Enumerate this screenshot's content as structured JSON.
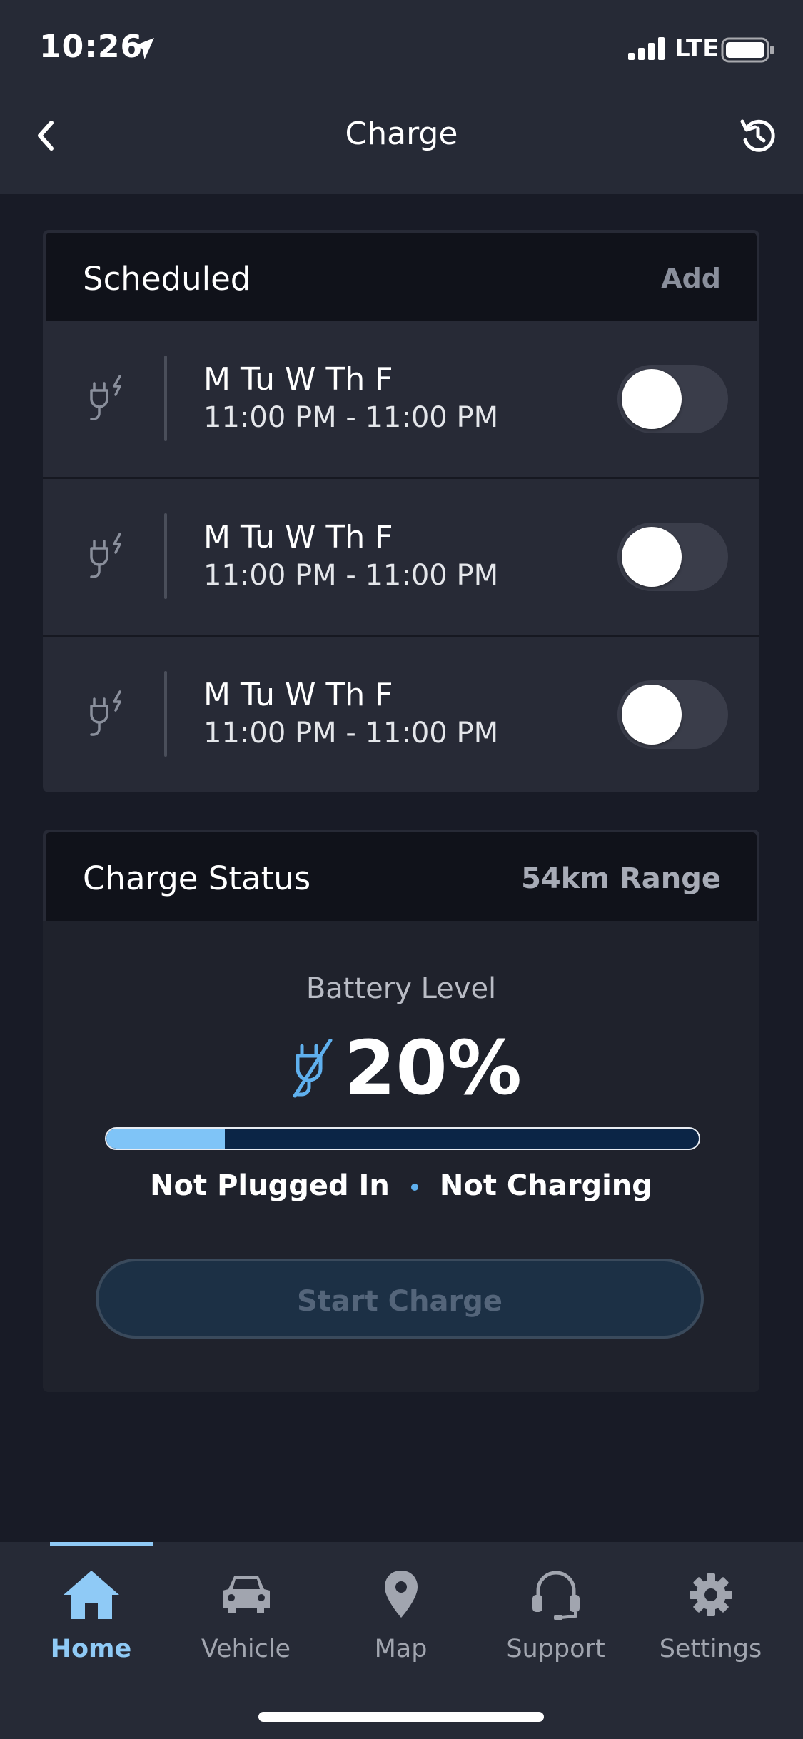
{
  "status_bar": {
    "time": "10:26",
    "network": "LTE"
  },
  "header": {
    "title": "Charge"
  },
  "scheduled": {
    "title": "Scheduled",
    "action": "Add",
    "items": [
      {
        "days": "M Tu W Th F",
        "time_range": "11:00 PM - 11:00 PM",
        "enabled": false
      },
      {
        "days": "M Tu W Th F",
        "time_range": "11:00 PM - 11:00 PM",
        "enabled": false
      },
      {
        "days": "M Tu W Th F",
        "time_range": "11:00 PM - 11:00 PM",
        "enabled": false
      }
    ]
  },
  "charge_status": {
    "title": "Charge Status",
    "range": "54km Range",
    "battery_label": "Battery Level",
    "battery_percent": "20%",
    "battery_fraction": 0.2,
    "plug_state": "Not Plugged In",
    "charge_state": "Not Charging",
    "start_button": "Start Charge"
  },
  "tabs": [
    {
      "label": "Home",
      "icon": "home-icon",
      "active": true
    },
    {
      "label": "Vehicle",
      "icon": "car-icon",
      "active": false
    },
    {
      "label": "Map",
      "icon": "map-pin-icon",
      "active": false
    },
    {
      "label": "Support",
      "icon": "headset-icon",
      "active": false
    },
    {
      "label": "Settings",
      "icon": "gear-icon",
      "active": false
    }
  ],
  "colors": {
    "accent": "#8fcaf6",
    "background": "#181b26",
    "card": "#272a36",
    "progress_fill": "#7fc4f7",
    "progress_track": "#0b2546"
  }
}
